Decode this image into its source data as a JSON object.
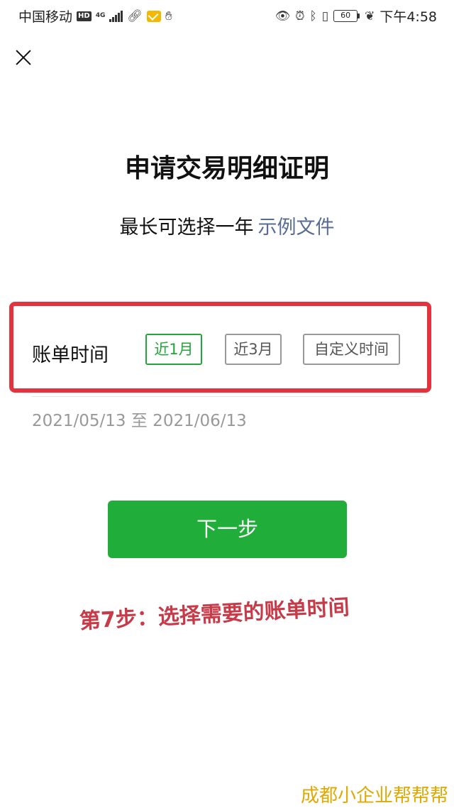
{
  "statusbar": {
    "carrier": "中国移动",
    "hd": "HD",
    "network": "4G",
    "battery": "60",
    "time": "下午4:58"
  },
  "page": {
    "title": "申请交易明细证明",
    "subtitle": "最长可选择一年",
    "example_link": "示例文件"
  },
  "range": {
    "label": "账单时间",
    "options": [
      "近1月",
      "近3月",
      "自定义时间"
    ],
    "selected": "近1月",
    "date_range": "2021/05/13 至 2021/06/13"
  },
  "next_button": "下一步",
  "annotation": "第7步：选择需要的账单时间",
  "watermark": "成都小企业帮帮帮",
  "colors": {
    "primary_green": "#20ad3a",
    "link": "#576b95",
    "highlight_red": "#e2333f",
    "annotation_red": "#c83a48",
    "watermark_gold": "#e0a800"
  }
}
